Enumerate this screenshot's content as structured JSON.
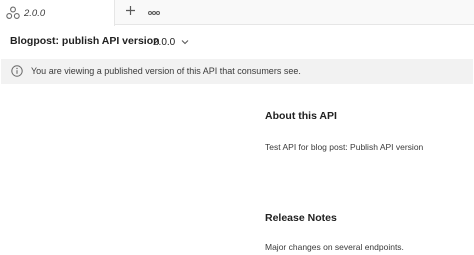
{
  "tabs": [
    {
      "label": "2.0.0",
      "icon": "api-icon",
      "active": true
    }
  ],
  "tabbar": {
    "add_icon": "plus-icon",
    "more_icon": "ellipsis-icon"
  },
  "header": {
    "title": "Blogpost: publish API version",
    "version": "2.0.0",
    "version_icon": "chevron-down-icon"
  },
  "banner": {
    "icon": "info-icon",
    "text": "You are viewing a published version of this API that consumers see."
  },
  "about": {
    "heading": "About this API",
    "description": "Test API for blog post: Publish API version"
  },
  "release_notes": {
    "heading": "Release Notes",
    "text": "Major changes on several endpoints."
  },
  "colors": {
    "text": "#212121",
    "muted": "#6b6b6b",
    "banner_bg": "#f2f2f2",
    "tabbar_bg": "#f9f9f9"
  }
}
